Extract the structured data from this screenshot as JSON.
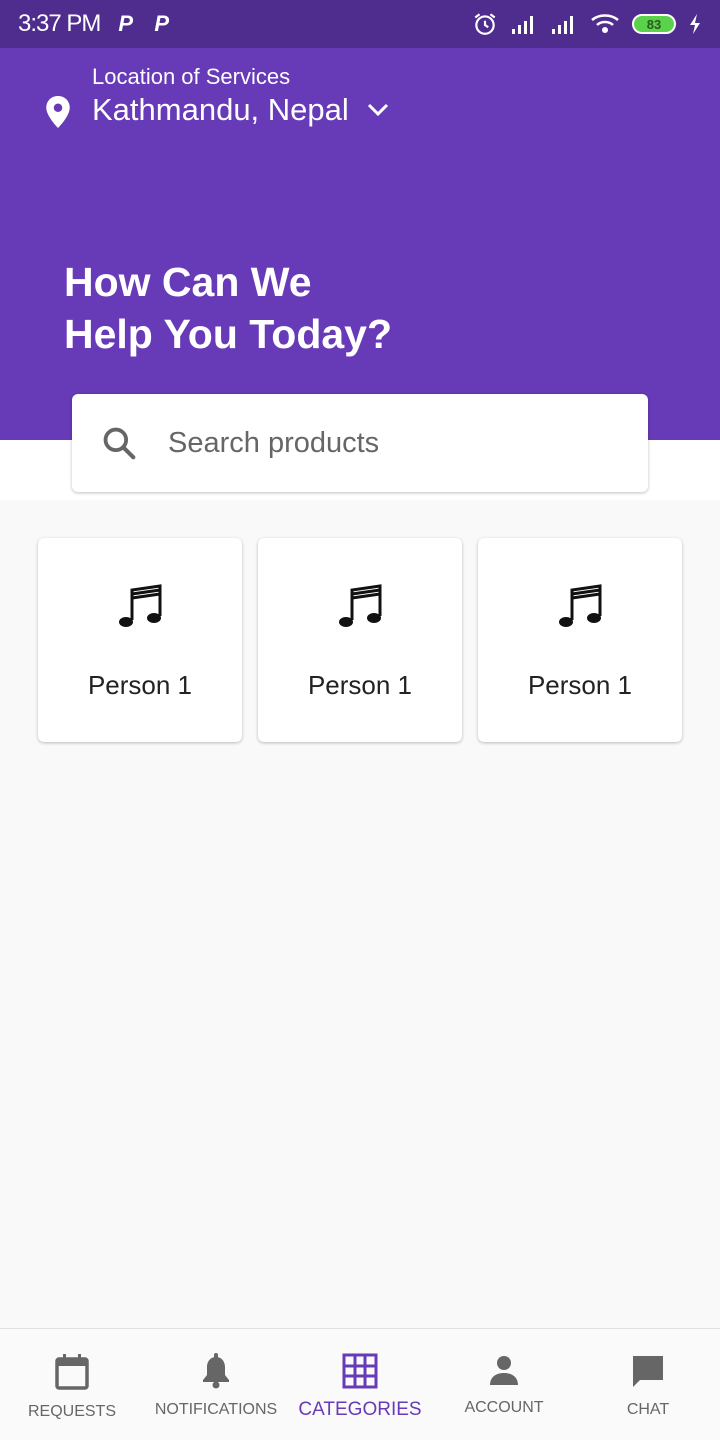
{
  "status": {
    "time": "3:37 PM",
    "battery": "83"
  },
  "location": {
    "label": "Location of Services",
    "value": "Kathmandu, Nepal"
  },
  "headline": {
    "line1": "How Can We",
    "line2": "Help You Today?"
  },
  "search": {
    "placeholder": "Search products"
  },
  "cards": [
    {
      "label": "Person 1",
      "icon": "music-note-icon"
    },
    {
      "label": "Person 1",
      "icon": "music-note-icon"
    },
    {
      "label": "Person 1",
      "icon": "music-note-icon"
    }
  ],
  "nav": {
    "items": [
      {
        "label": "REQUESTS",
        "icon": "calendar-icon"
      },
      {
        "label": "NOTIFICATIONS",
        "icon": "bell-icon"
      },
      {
        "label": "CATEGORIES",
        "icon": "grid-icon"
      },
      {
        "label": "ACCOUNT",
        "icon": "person-icon"
      },
      {
        "label": "CHAT",
        "icon": "chat-icon"
      }
    ],
    "active_index": 2
  },
  "colors": {
    "primary": "#673ab7",
    "status_bar": "#4f2d8e",
    "background": "#f9f9f9"
  }
}
